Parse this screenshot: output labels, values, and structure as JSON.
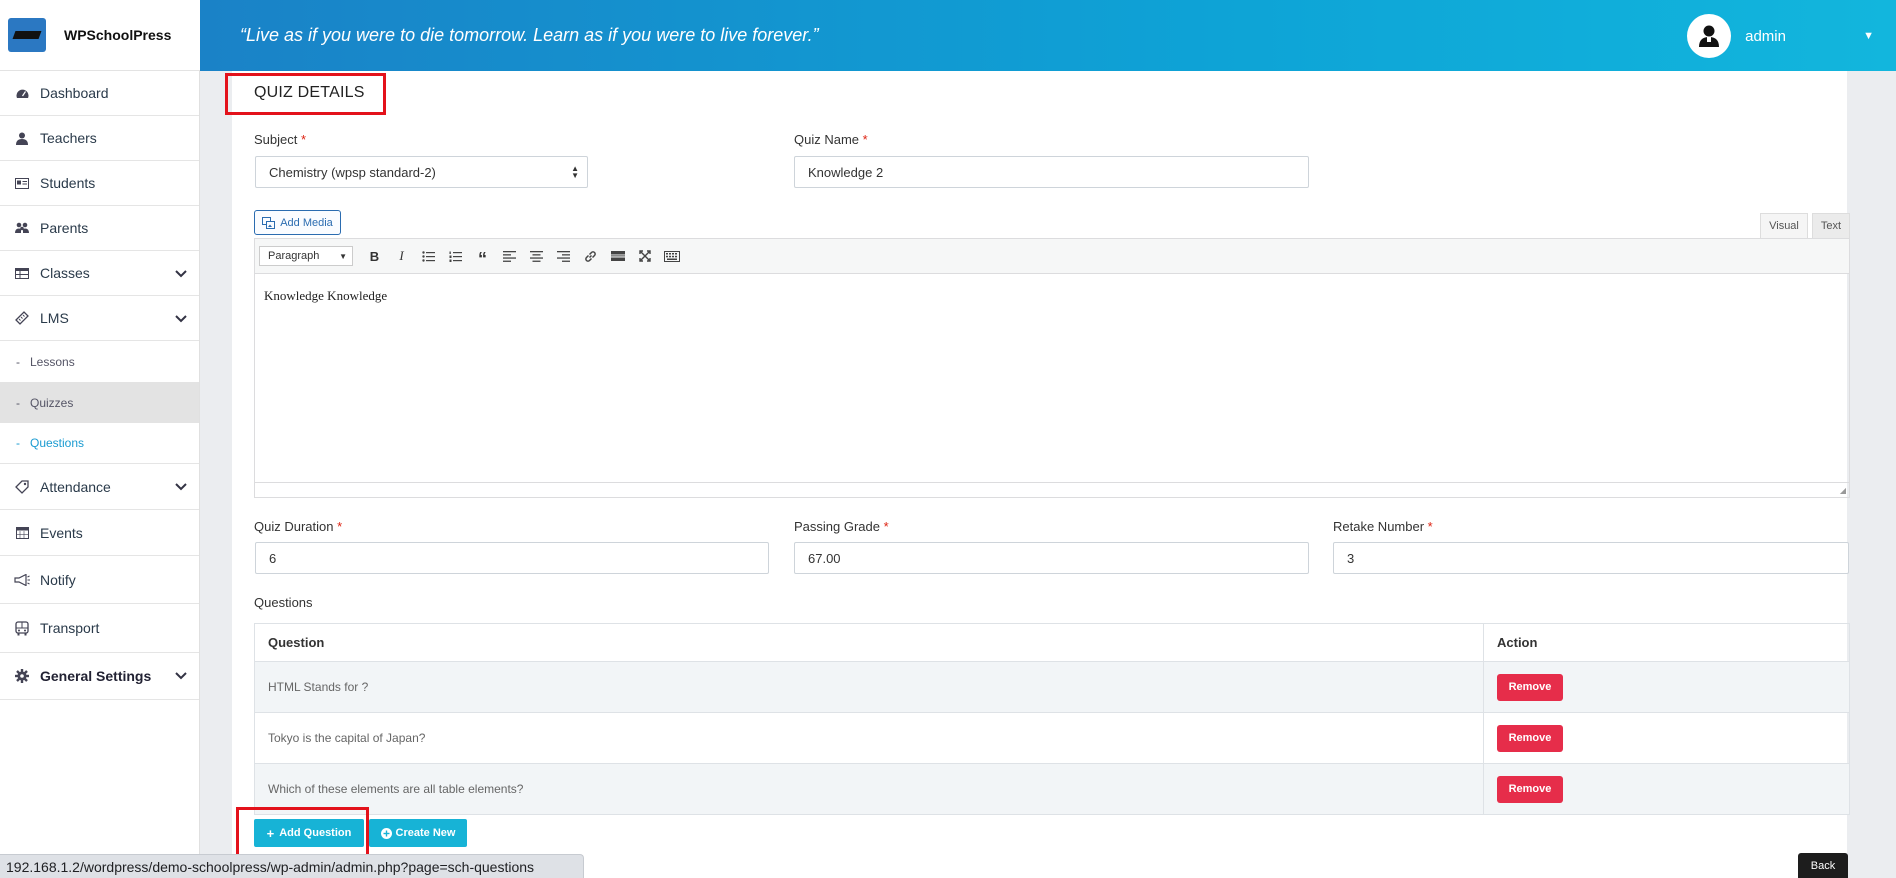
{
  "brand": {
    "name": "WPSchoolPress"
  },
  "header": {
    "quote": "“Live as if you were to die tomorrow. Learn as if you were to live forever.”",
    "user_name": "admin"
  },
  "sidebar": {
    "items": [
      {
        "label": "Dashboard",
        "icon": "dashboard-icon"
      },
      {
        "label": "Teachers",
        "icon": "teacher-icon"
      },
      {
        "label": "Students",
        "icon": "student-card-icon"
      },
      {
        "label": "Parents",
        "icon": "parents-icon"
      },
      {
        "label": "Classes",
        "icon": "table-icon"
      },
      {
        "label": "LMS",
        "icon": "ruler-icon"
      }
    ],
    "lms_sub": [
      "Lessons",
      "Quizzes",
      "Questions"
    ],
    "items2": [
      {
        "label": "Attendance"
      },
      {
        "label": "Events"
      },
      {
        "label": "Notify"
      },
      {
        "label": "Transport"
      },
      {
        "label": "General Settings"
      }
    ]
  },
  "form": {
    "title": "QUIZ DETAILS",
    "subject_label": "Subject",
    "subject_value": "Chemistry (wpsp standard-2)",
    "quiz_name_label": "Quiz Name",
    "quiz_name_value": "Knowledge 2",
    "add_media": "Add Media",
    "tab_visual": "Visual",
    "tab_text": "Text",
    "format_value": "Paragraph",
    "editor_content": "Knowledge Knowledge",
    "duration_label": "Quiz Duration",
    "duration_value": "6",
    "passing_label": "Passing Grade",
    "passing_value": "67.00",
    "retake_label": "Retake Number",
    "retake_value": "3",
    "required_mark": "*"
  },
  "questions": {
    "section_label": "Questions",
    "col_question": "Question",
    "col_action": "Action",
    "rows": [
      {
        "question": "HTML Stands for ?",
        "action": "Remove"
      },
      {
        "question": "Tokyo is the capital of Japan?",
        "action": "Remove"
      },
      {
        "question": "Which of these elements are all table elements?",
        "action": "Remove"
      }
    ]
  },
  "buttons": {
    "add_question": "Add Question",
    "create_new": "Create New",
    "back": "Back"
  },
  "statusbar": {
    "url": "192.168.1.2/wordpress/demo-schoolpress/wp-admin/admin.php?page=sch-questions"
  },
  "colors": {
    "accent": "#17b3d6",
    "danger": "#e62d4a",
    "highlight": "#e3121b"
  }
}
